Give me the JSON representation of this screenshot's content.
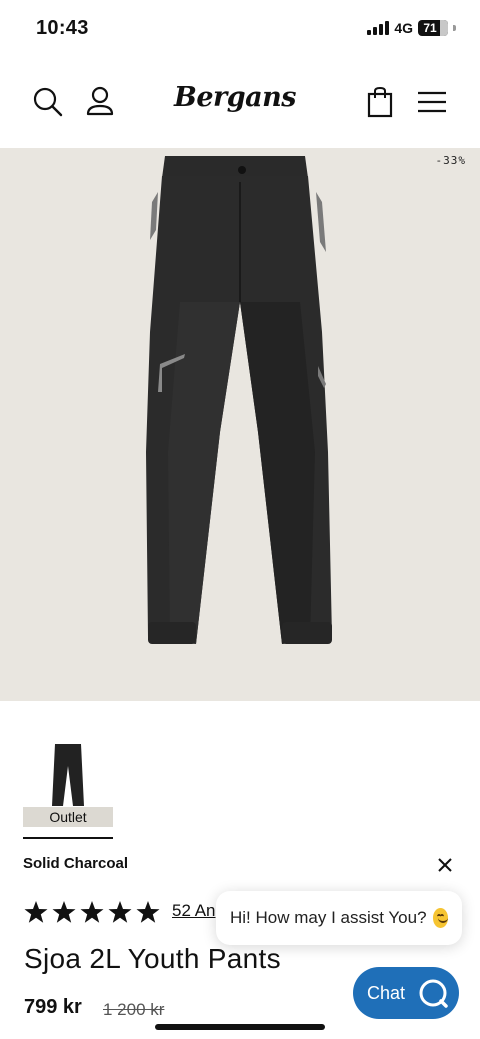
{
  "status_bar": {
    "time": "10:43",
    "network": "4G",
    "battery": "71"
  },
  "header": {
    "logo": "Bergans",
    "icons": [
      "search-icon",
      "account-icon",
      "bag-icon",
      "menu-icon"
    ]
  },
  "hero": {
    "discount_badge": "-33%"
  },
  "variant": {
    "thumbnail_badge": "Outlet",
    "color_name": "Solid Charcoal"
  },
  "rating": {
    "stars": 5,
    "review_text": "52 An"
  },
  "chat": {
    "greeting": "Hi! How may I assist You?",
    "button_label": "Chat"
  },
  "product": {
    "title": "Sjoa 2L Youth Pants",
    "price": "799 kr",
    "old_price": "1 200 kr"
  },
  "colors": {
    "hero_background": "#e9e6e0",
    "chat_button": "#1f6fb8",
    "thumb_badge": "#dcd9d2"
  }
}
